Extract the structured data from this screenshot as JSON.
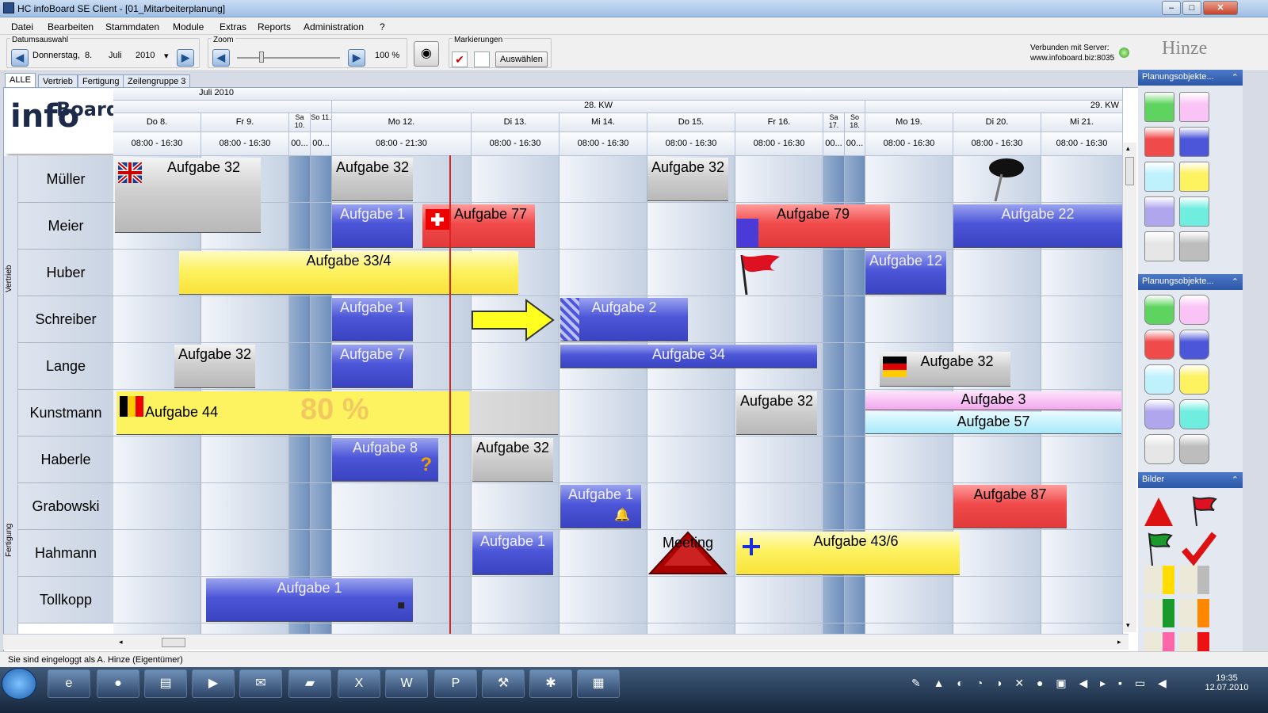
{
  "window": {
    "title": "HC infoBoard SE Client - [01_Mitarbeiterplanung]"
  },
  "menu": [
    "Datei",
    "Bearbeiten",
    "Stammdaten",
    "Module",
    "Extras",
    "Reports",
    "Administration",
    "?"
  ],
  "toolbar": {
    "date_label": "Datumsauswahl",
    "weekday": "Donnerstag,",
    "day": "8.",
    "month": "Juli",
    "year": "2010",
    "zoom_label": "Zoom",
    "zoom_value": "100 %",
    "mark_label": "Markierungen",
    "select_btn": "Auswählen",
    "server_label": "Verbunden mit Server:",
    "server_url": "www.infoboard.biz:8035",
    "brand": "Hinze"
  },
  "tabs": [
    "ALLE",
    "Vertrieb",
    "Fertigung",
    "Zeilengruppe 3"
  ],
  "header": {
    "month": "Juli 2010",
    "kw28": "28. KW",
    "kw29": "29. KW"
  },
  "logo": {
    "part1": "info",
    "part2": "Board"
  },
  "groups": [
    "Vertrieb",
    "Fertigung"
  ],
  "days": [
    {
      "d": "Do 8.",
      "h": "08:00 - 16:30"
    },
    {
      "d": "Fr 9.",
      "h": "08:00 - 16:30"
    },
    {
      "d": "Sa 10.",
      "h": "00..."
    },
    {
      "d": "So 11.",
      "h": "00..."
    },
    {
      "d": "Mo 12.",
      "h": "08:00 - 21:30"
    },
    {
      "d": "Di 13.",
      "h": "08:00 - 16:30"
    },
    {
      "d": "Mi 14.",
      "h": "08:00 - 16:30"
    },
    {
      "d": "Do 15.",
      "h": "08:00 - 16:30"
    },
    {
      "d": "Fr 16.",
      "h": "08:00 - 16:30"
    },
    {
      "d": "Sa 17.",
      "h": "00..."
    },
    {
      "d": "So 18.",
      "h": "00..."
    },
    {
      "d": "Mo 19.",
      "h": "08:00 - 16:30"
    },
    {
      "d": "Di 20.",
      "h": "08:00 - 16:30"
    },
    {
      "d": "Mi 21.",
      "h": "08:00 - 16:30"
    }
  ],
  "rows": [
    "Müller",
    "Meier",
    "Huber",
    "Schreiber",
    "Lange",
    "Kunstmann",
    "Haberle",
    "Grabowski",
    "Hahmann",
    "Tollkopp"
  ],
  "tasks": {
    "t1": "Aufgabe 32",
    "t2": "Aufgabe 32",
    "t3": "Aufgabe 32",
    "t4": "Aufgabe 1",
    "t5": "Aufgabe 77",
    "t6": "Aufgabe 79",
    "t7": "Aufgabe 22",
    "t8": "Aufgabe 33/4",
    "t9": "Aufgabe 12",
    "t10": "Aufgabe 1",
    "t11": "Aufgabe 2",
    "t12": "Aufgabe 32",
    "t13": "Aufgabe 7",
    "t14": "Aufgabe 34",
    "t15": "Aufgabe 32",
    "t16": "Aufgabe 44",
    "t16p": "80 %",
    "t17": "Aufgabe 32",
    "t18": "Aufgabe 3",
    "t19": "Aufgabe 57",
    "t20": "Aufgabe 8",
    "t21": "Aufgabe 32",
    "t22": "Aufgabe 1",
    "t23": "Aufgabe 87",
    "t24": "Aufgabe 1",
    "t25": "Meeting",
    "t26": "Aufgabe 43/6",
    "t27": "Aufgabe 1"
  },
  "side": {
    "h1": "Planungsobjekte...",
    "h2": "Planungsobjekte...",
    "h3": "Bilder"
  },
  "colors": {
    "green": "#5fd35f",
    "pink": "#f9c4f5",
    "red": "#f04a4a",
    "blue": "#4c56d8",
    "cyan": "#bff1fd",
    "yellow": "#fdf260",
    "lav": "#b0a6ee",
    "teal": "#6feee0",
    "lgray": "#e6e6e6",
    "gray": "#bdbdbd"
  },
  "status": "Sie sind eingeloggt als A. Hinze (Eigentümer)",
  "clock": {
    "time": "19:35",
    "date": "12.07.2010"
  }
}
